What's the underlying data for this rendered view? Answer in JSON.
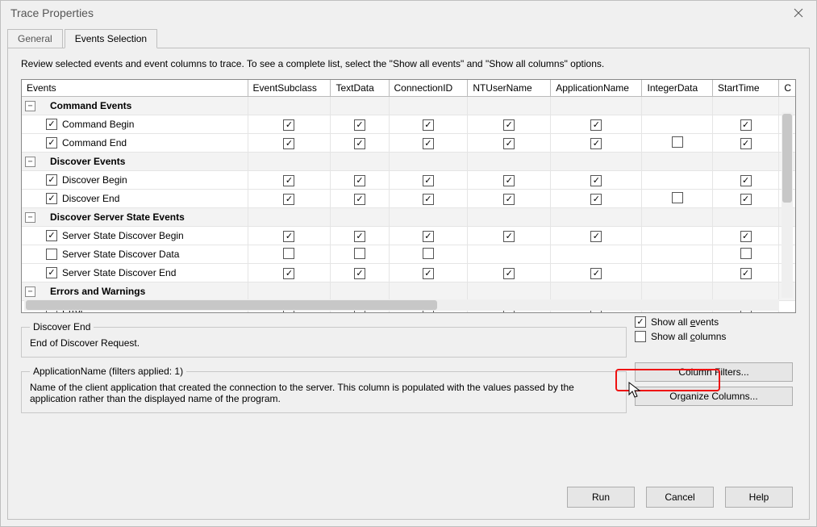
{
  "window": {
    "title": "Trace Properties"
  },
  "tabs": {
    "general": "General",
    "events": "Events Selection"
  },
  "instruction": "Review selected events and event columns to trace. To see a complete list, select the \"Show all events\" and \"Show all columns\" options.",
  "columns": [
    "Events",
    "EventSubclass",
    "TextData",
    "ConnectionID",
    "NTUserName",
    "ApplicationName",
    "IntegerData",
    "StartTime",
    "C"
  ],
  "tree": [
    {
      "type": "cat",
      "expanded": true,
      "label": "Command Events"
    },
    {
      "type": "evt",
      "on": true,
      "label": "Command Begin",
      "cells": [
        true,
        true,
        true,
        true,
        true,
        null,
        true,
        null
      ]
    },
    {
      "type": "evt",
      "on": true,
      "label": "Command End",
      "cells": [
        true,
        true,
        true,
        true,
        true,
        false,
        true,
        null
      ]
    },
    {
      "type": "cat",
      "expanded": true,
      "label": "Discover Events"
    },
    {
      "type": "evt",
      "on": true,
      "label": "Discover Begin",
      "cells": [
        true,
        true,
        true,
        true,
        true,
        null,
        true,
        null
      ]
    },
    {
      "type": "evt",
      "on": true,
      "label": "Discover End",
      "cells": [
        true,
        true,
        true,
        true,
        true,
        false,
        true,
        null
      ]
    },
    {
      "type": "cat",
      "expanded": true,
      "label": "Discover Server State Events"
    },
    {
      "type": "evt",
      "on": true,
      "label": "Server State Discover Begin",
      "cells": [
        true,
        true,
        true,
        true,
        true,
        null,
        true,
        null
      ]
    },
    {
      "type": "evt",
      "on": false,
      "label": "Server State Discover Data",
      "cells": [
        false,
        false,
        false,
        null,
        null,
        null,
        false,
        null
      ]
    },
    {
      "type": "evt",
      "on": true,
      "label": "Server State Discover End",
      "cells": [
        true,
        true,
        true,
        true,
        true,
        null,
        true,
        null
      ]
    },
    {
      "type": "cat",
      "expanded": true,
      "label": "Errors and Warnings"
    },
    {
      "type": "evt",
      "on": false,
      "label": "Error",
      "cells": [
        false,
        false,
        false,
        false,
        false,
        null,
        false,
        null
      ]
    }
  ],
  "desc_box": {
    "legend": "Discover End",
    "text": "End of Discover Request."
  },
  "opts": {
    "show_events": {
      "label_pre": "Show all ",
      "u": "e",
      "label_post": "vents",
      "checked": true
    },
    "show_columns": {
      "label_pre": "Show all ",
      "u": "c",
      "label_post": "olumns",
      "checked": false
    }
  },
  "filters_box": {
    "legend": "ApplicationName (filters applied: 1)",
    "text": "Name of the client application that created the connection to the server. This column is populated with the values passed by the application rather than the displayed name of the program."
  },
  "buttons": {
    "column_filters": "Column Filters...",
    "organize_columns": "Organize Columns...",
    "run": "Run",
    "cancel": "Cancel",
    "help": "Help"
  }
}
